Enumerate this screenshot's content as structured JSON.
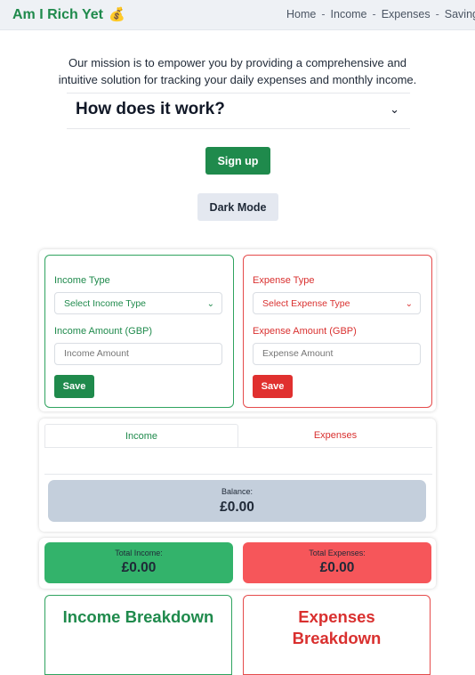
{
  "nav": {
    "brand": "Am I Rich Yet",
    "brand_emoji": "💰",
    "links": [
      "Home",
      "Income",
      "Expenses",
      "Savings"
    ]
  },
  "hero": {
    "mission": "Our mission is to empower you by providing a comprehensive and intuitive solution for tracking your daily expenses and monthly income.",
    "faq_question": "How does it work?",
    "signup_label": "Sign up",
    "darkmode_label": "Dark Mode"
  },
  "income_form": {
    "type_label": "Income Type",
    "type_selected": "Select Income Type",
    "amount_label": "Income Amount (GBP)",
    "amount_placeholder": "Income Amount",
    "save_label": "Save"
  },
  "expense_form": {
    "type_label": "Expense Type",
    "type_selected": "Select Expense Type",
    "amount_label": "Expense Amount (GBP)",
    "amount_placeholder": "Expense Amount",
    "save_label": "Save"
  },
  "records": {
    "tabs": [
      "Income",
      "Expenses"
    ],
    "balance_label": "Balance:",
    "balance_value": "£0.00"
  },
  "totals": {
    "income_label": "Total Income:",
    "income_value": "£0.00",
    "expense_label": "Total Expenses:",
    "expense_value": "£0.00"
  },
  "breakdown": {
    "income_title": "Income Breakdown",
    "expense_title": "Expenses Breakdown"
  },
  "colors": {
    "income": "#1f8a4c",
    "expense": "#d9302f",
    "nav_bg": "#eef1f5",
    "balance_bg": "#c4cfdc",
    "total_income_bg": "#33b36b",
    "total_expense_bg": "#f6565a"
  }
}
